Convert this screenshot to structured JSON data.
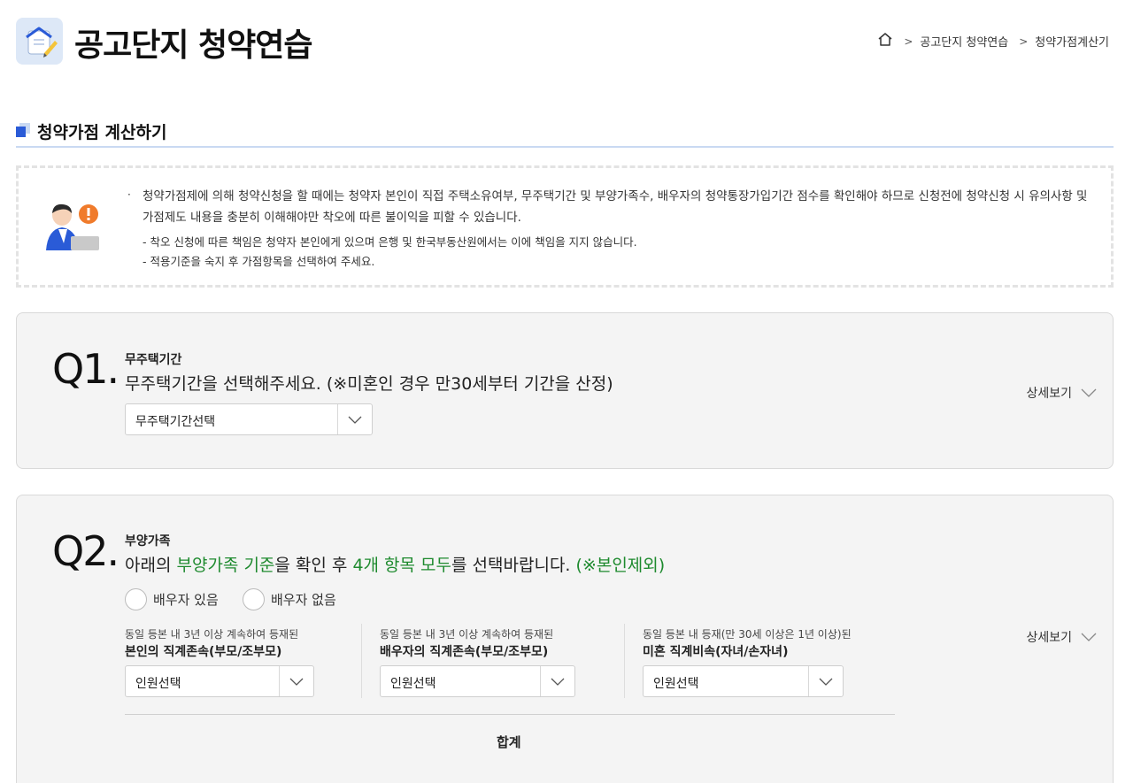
{
  "header": {
    "title": "공고단지 청약연습",
    "breadcrumb": [
      "공고단지 청약연습",
      "청약가점계산기"
    ]
  },
  "section": {
    "title": "청약가점 계산하기"
  },
  "notice": {
    "main": "청약가점제에 의해 청약신청을 할 때에는 청약자 본인이 직접 주택소유여부, 무주택기간 및 부양가족수, 배우자의 청약통장가입기간 점수를 확인해야 하므로 신청전에 청약신청 시 유의사항 및 가점제도 내용을 충분히 이해해야만 착오에 따른 불이익을 피할 수 있습니다.",
    "sub1": "- 착오 신청에 따른 책임은 청약자 본인에게 있으며 은행 및 한국부동산원에서는 이에 책임을 지지 않습니다.",
    "sub2": "- 적용기준을 숙지 후 가점항목을 선택하여 주세요."
  },
  "q1": {
    "num": "Q1.",
    "label": "무주택기간",
    "question": "무주택기간을 선택해주세요. (※미혼인 경우 만30세부터 기간을 산정)",
    "select": "무주택기간선택",
    "detail": "상세보기"
  },
  "q2": {
    "num": "Q2.",
    "label": "부양가족",
    "q_part1": "아래의 ",
    "q_green1": "부양가족 기준",
    "q_part2": "을 확인 후 ",
    "q_green2": "4개 항목 모두",
    "q_part3": "를 선택바랍니다. ",
    "q_green3": "(※본인제외)",
    "radio1": "배우자 있음",
    "radio2": "배우자 없음",
    "detail": "상세보기",
    "columns": [
      {
        "label1": "동일 등본 내 3년 이상 계속하여 등재된",
        "label2": "본인의 직계존속(부모/조부모)",
        "select": "인원선택"
      },
      {
        "label1": "동일 등본 내 3년 이상 계속하여 등재된",
        "label2": "배우자의 직계존속(부모/조부모)",
        "select": "인원선택"
      },
      {
        "label1": "동일 등본 내 등재(만 30세 이상은 1년 이상)된",
        "label2": "미혼 직계비속(자녀/손자녀)",
        "select": "인원선택"
      }
    ],
    "total": "합계"
  },
  "colors": {
    "accent_green": "#1e8a2e",
    "accent_blue": "#2a5bd7"
  }
}
